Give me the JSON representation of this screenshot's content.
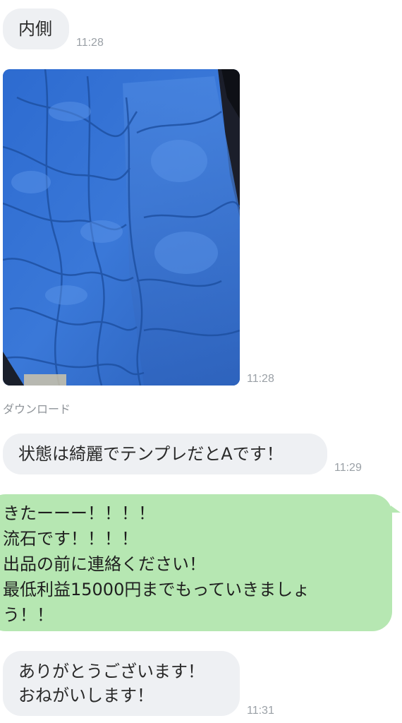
{
  "messages": [
    {
      "text": "内側",
      "time": "11:28"
    },
    {
      "photo_time": "11:28",
      "download_label": "ダウンロード"
    },
    {
      "text": "状態は綺麗でテンプレだとAです！",
      "time": "11:29"
    },
    {
      "lines": [
        "きたーーー！！！！",
        "流石です！！！！",
        "出品の前に連絡ください！",
        "最低利益15000円までもっていきましょ",
        "う！！"
      ]
    },
    {
      "lines": [
        "ありがとうございます！",
        "おねがいします！"
      ],
      "time": "11:31"
    }
  ],
  "colors": {
    "incoming_bubble": "#eef0f3",
    "outgoing_bubble": "#b6e7b2",
    "timestamp": "#9aa0a6",
    "photo_main": "#2f67c4"
  }
}
